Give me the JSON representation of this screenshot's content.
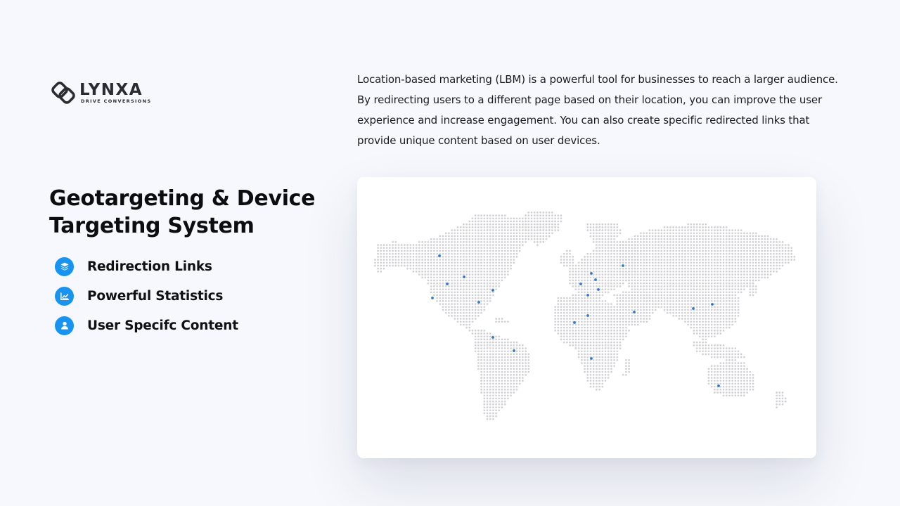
{
  "brand": {
    "name": "LYNXA",
    "tagline": "DRIVE CONVERSIONS",
    "logo_icon": "interlocking-links-icon"
  },
  "hero": {
    "title": "Geotargeting & Device Targeting System"
  },
  "features": [
    {
      "label": "Redirection Links",
      "icon": "layers-icon"
    },
    {
      "label": "Powerful Statistics",
      "icon": "chart-icon"
    },
    {
      "label": "User Specifc Content",
      "icon": "user-icon"
    }
  ],
  "description": "Location-based marketing (LBM) is a powerful tool for businesses to reach a larger audience. By redirecting users to a different page based on their location, you can improve the user experience and increase engagement. You can also create specific redirected links that provide unique content based on user devices.",
  "colors": {
    "accent": "#1893f0",
    "map_dot": "#d0d0d4",
    "map_marker": "#2f77c8",
    "background": "#f6f8fd"
  },
  "map": {
    "image": "dotted-world-map",
    "marker_icon": "location-marker-icon"
  }
}
